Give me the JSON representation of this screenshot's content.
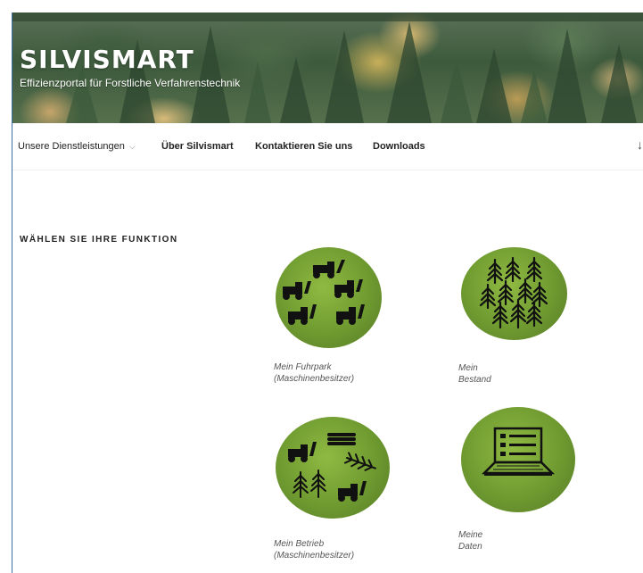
{
  "header": {
    "site_title": "SILVISMART",
    "tagline": "Effizienzportal für Forstliche Verfahrenstechnik"
  },
  "nav": {
    "items": [
      {
        "label": "Unsere Dienstleistungen",
        "has_dropdown": true
      },
      {
        "label": "Über Silvismart"
      },
      {
        "label": "Kontaktieren Sie uns"
      },
      {
        "label": "Downloads"
      }
    ],
    "scroll_icon": "↓"
  },
  "main": {
    "heading": "WÄHLEN SIE IHRE FUNKTION",
    "tiles": [
      {
        "line1": "Mein Fuhrpark",
        "line2": "(Maschinenbesitzer)",
        "icon": "machines-icon"
      },
      {
        "line1": "Mein Bestand",
        "line2": "",
        "icon": "forest-icon"
      },
      {
        "line1": "Mein Betrieb",
        "line2": "(Maschinenbesitzer)",
        "icon": "operations-icon"
      },
      {
        "line1": "Meine Daten",
        "line2": "",
        "icon": "laptop-icon"
      }
    ]
  },
  "colors": {
    "tile_green": "#6f9a30",
    "frame_blue": "#3f6fa6",
    "text_dark": "#222222"
  }
}
